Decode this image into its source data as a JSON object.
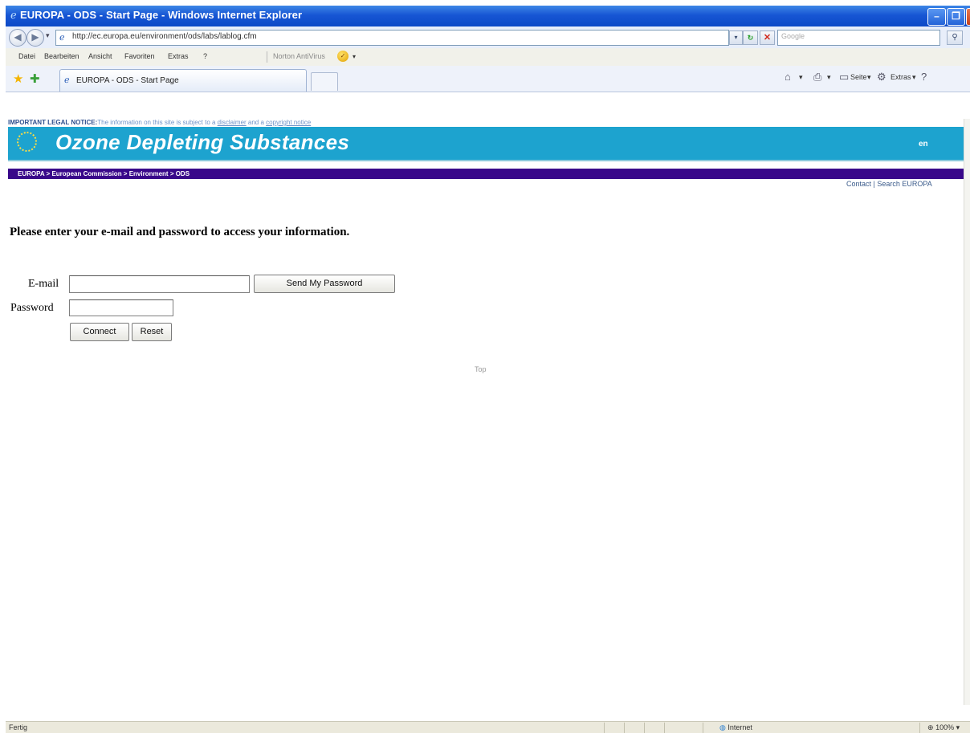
{
  "window": {
    "title": "EUROPA - ODS - Start Page - Windows Internet Explorer",
    "url": "http://ec.europa.eu/environment/ods/labs/lablog.cfm",
    "search_placeholder": "Google"
  },
  "menu": {
    "items": [
      "Datei",
      "Bearbeiten",
      "Ansicht",
      "Favoriten",
      "Extras",
      "?"
    ],
    "norton": "Norton AntiVirus"
  },
  "tab": {
    "label": "EUROPA - ODS - Start Page"
  },
  "commands": {
    "page": "Seite",
    "tools": "Extras"
  },
  "page": {
    "notice_label": "IMPORTANT LEGAL NOTICE:",
    "notice_text": "The information on this site is subject to a ",
    "notice_link1": "disclaimer",
    "notice_mid": " and a ",
    "notice_link2": "copyright notice",
    "banner_title": "Ozone Depleting Substances",
    "language": "en",
    "breadcrumb": "EUROPA > European Commission > Environment > ODS",
    "toplinks": "Contact | Search EUROPA",
    "prompt": "Please enter your e-mail and password to access your information.",
    "email_label": "E-mail",
    "password_label": "Password",
    "send_password_button": "Send My Password",
    "connect_button": "Connect",
    "reset_button": "Reset",
    "top_link": "Top"
  },
  "status": {
    "text": "Fertig",
    "zone": "Internet",
    "zoom": "100%"
  },
  "colors": {
    "titlebar": "#1756d4",
    "banner": "#1da3cf",
    "breadcrumb_bar": "#39088a"
  }
}
